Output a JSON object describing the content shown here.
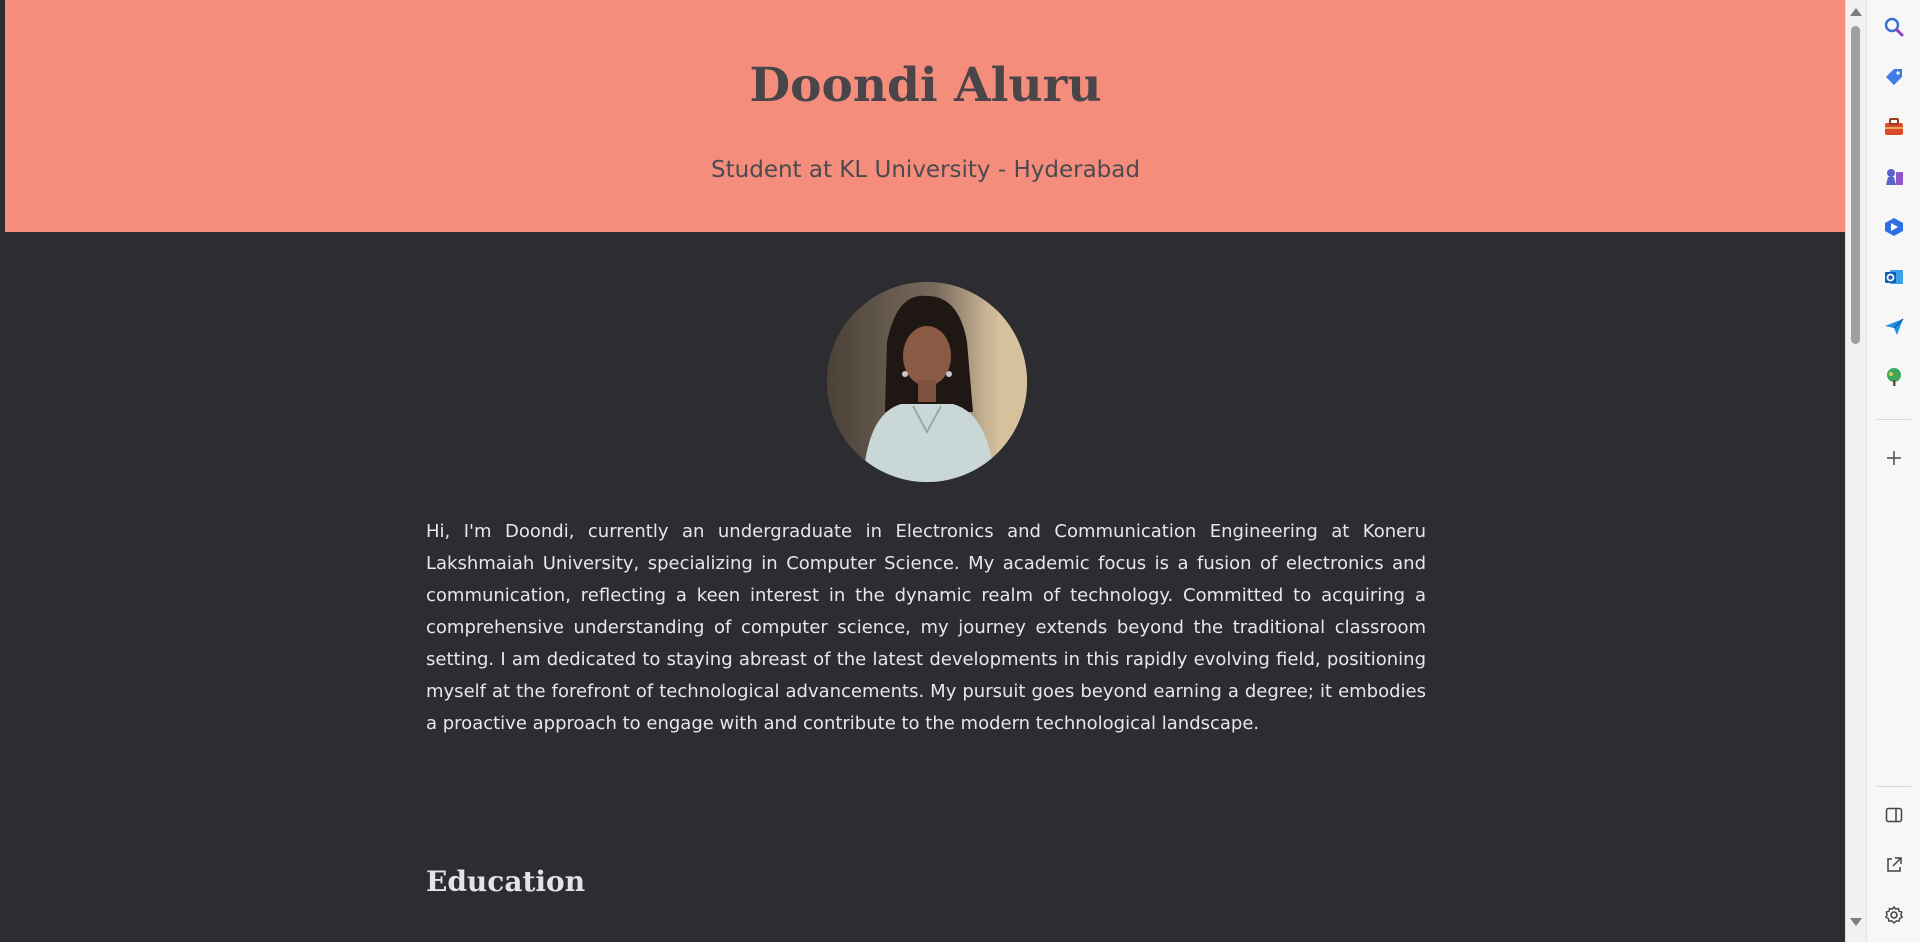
{
  "header": {
    "name": "Doondi Aluru",
    "tagline": "Student at KL University - Hyderabad"
  },
  "profile": {
    "bio": "Hi, I'm Doondi, currently an undergraduate in Electronics and Communication Engineering at Koneru Lakshmaiah University, specializing in Computer Science. My academic focus is a fusion of electronics and communication, reflecting a keen interest in the dynamic realm of technology. Committed to acquiring a comprehensive understanding of computer science, my journey extends beyond the traditional classroom setting. I am dedicated to staying abreast of the latest developments in this rapidly evolving field, positioning myself at the forefront of technological advancements. My pursuit goes beyond earning a degree; it embodies a proactive approach to engage with and contribute to the modern technological landscape."
  },
  "sections": {
    "education_title": "Education"
  },
  "colors": {
    "header_bg": "#f58d7c",
    "page_bg": "#2c2c31",
    "title_text": "#4a4548",
    "body_text": "#e8e6e9"
  },
  "sidebar": {
    "icons": [
      "search-icon",
      "shopping-tag-icon",
      "toolbox-icon",
      "chess-games-icon",
      "copilot-icon",
      "outlook-icon",
      "send-icon",
      "tree-icon",
      "add-icon",
      "split-screen-icon",
      "open-external-icon",
      "settings-icon"
    ]
  }
}
